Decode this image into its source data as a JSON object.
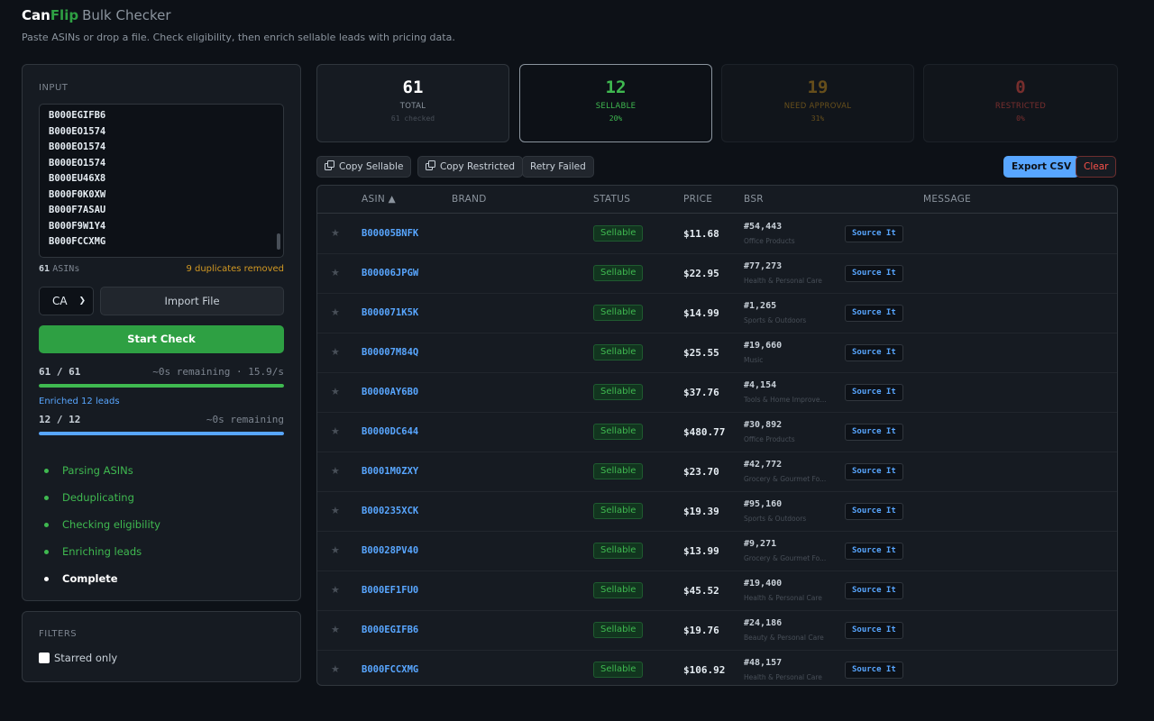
{
  "app": {
    "brand_can": "Can",
    "brand_flip": "Flip",
    "title": "Bulk Checker",
    "tagline": "Paste ASINs or drop a file. Check eligibility, then enrich sellable leads with pricing data."
  },
  "input": {
    "label": "INPUT",
    "asins": [
      "B000EGIFB6",
      "B000EO1574",
      "B000EO1574",
      "B000EO1574",
      "B000EU46X8",
      "B000F0K0XW",
      "B000F7ASAU",
      "B000F9W1Y4",
      "B000FCCXMG"
    ],
    "count": "61",
    "count_label": "ASINs",
    "duplicates": "9 duplicates removed",
    "marketplace": "CA",
    "import_label": "Import File",
    "start_label": "Start Check",
    "progress": {
      "text": "61 / 61",
      "rate": "~0s remaining · 15.9/s",
      "fraction": 1.0,
      "color": "#3fb950"
    },
    "enriched_label": "Enriched 12 leads",
    "enrich_progress": {
      "text": "12 / 12",
      "remaining": "~0s remaining",
      "fraction": 1.0,
      "color": "#58a6ff"
    },
    "steps": [
      "Parsing ASINs",
      "Deduplicating",
      "Checking eligibility",
      "Enriching leads",
      "Complete"
    ]
  },
  "filters": {
    "label": "FILTERS",
    "starred_only": "Starred only"
  },
  "stats": {
    "total": {
      "value": "61",
      "label": "TOTAL",
      "sub": "61 checked"
    },
    "sellable": {
      "value": "12",
      "label": "SELLABLE",
      "sub": "20%"
    },
    "approval": {
      "value": "19",
      "label": "NEED APPROVAL",
      "sub": "31%"
    },
    "restricted": {
      "value": "0",
      "label": "RESTRICTED",
      "sub": "0%"
    }
  },
  "toolbar": {
    "copy_sellable": "Copy Sellable",
    "copy_restricted": "Copy Restricted",
    "retry_failed": "Retry Failed",
    "export_csv": "Export CSV",
    "clear": "Clear"
  },
  "table": {
    "columns": {
      "asin": "ASIN ▲",
      "brand": "BRAND",
      "status": "STATUS",
      "price": "PRICE",
      "bsr": "BSR",
      "message": "MESSAGE"
    },
    "source_label": "Source It",
    "star_glyph": "★",
    "rows": [
      {
        "asin": "B00005BNFK",
        "status": "Sellable",
        "price": "$11.68",
        "bsr": "#54,443",
        "category": "Office Products"
      },
      {
        "asin": "B00006JPGW",
        "status": "Sellable",
        "price": "$22.95",
        "bsr": "#77,273",
        "category": "Health & Personal Care"
      },
      {
        "asin": "B000071K5K",
        "status": "Sellable",
        "price": "$14.99",
        "bsr": "#1,265",
        "category": "Sports & Outdoors"
      },
      {
        "asin": "B00007M84Q",
        "status": "Sellable",
        "price": "$25.55",
        "bsr": "#19,660",
        "category": "Music"
      },
      {
        "asin": "B0000AY6B0",
        "status": "Sellable",
        "price": "$37.76",
        "bsr": "#4,154",
        "category": "Tools & Home Improve..."
      },
      {
        "asin": "B0000DC644",
        "status": "Sellable",
        "price": "$480.77",
        "bsr": "#30,892",
        "category": "Office Products"
      },
      {
        "asin": "B0001M0ZXY",
        "status": "Sellable",
        "price": "$23.70",
        "bsr": "#42,772",
        "category": "Grocery & Gourmet Fo..."
      },
      {
        "asin": "B000235XCK",
        "status": "Sellable",
        "price": "$19.39",
        "bsr": "#95,160",
        "category": "Sports & Outdoors"
      },
      {
        "asin": "B00028PV40",
        "status": "Sellable",
        "price": "$13.99",
        "bsr": "#9,271",
        "category": "Grocery & Gourmet Fo..."
      },
      {
        "asin": "B000EF1FU0",
        "status": "Sellable",
        "price": "$45.52",
        "bsr": "#19,400",
        "category": "Health & Personal Care"
      },
      {
        "asin": "B000EGIFB6",
        "status": "Sellable",
        "price": "$19.76",
        "bsr": "#24,186",
        "category": "Beauty & Personal Care"
      },
      {
        "asin": "B000FCCXMG",
        "status": "Sellable",
        "price": "$106.92",
        "bsr": "#48,157",
        "category": "Health & Personal Care"
      }
    ]
  }
}
